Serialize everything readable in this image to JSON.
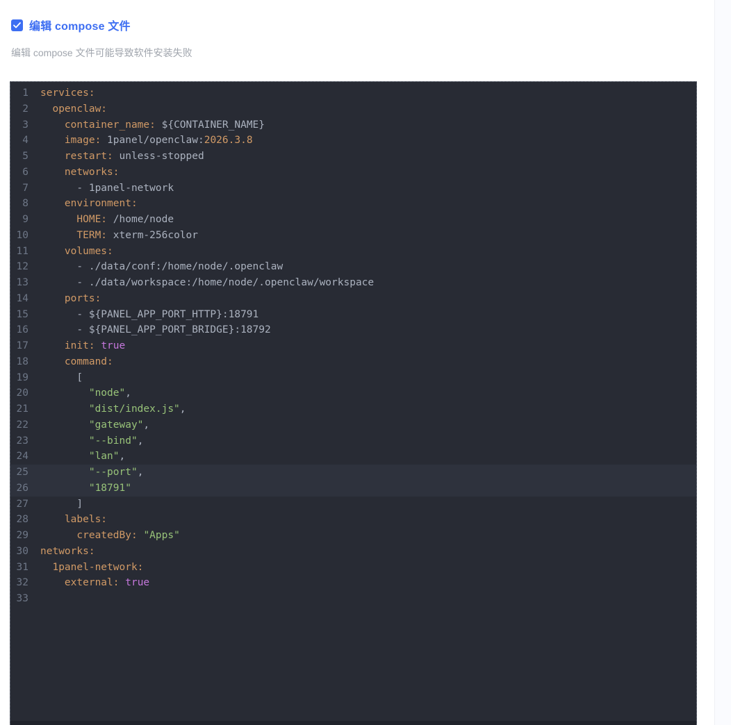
{
  "header": {
    "checkbox_checked": true,
    "title": "编辑 compose 文件",
    "subtitle": "编辑 compose 文件可能导致软件安装失败"
  },
  "colors": {
    "accent": "#3d6ef2",
    "subtitle_text": "#a0a5ad",
    "editor_background": "#282b34",
    "editor_border": "#8a919e",
    "gutter_number": "#6e7787",
    "line_highlight": "#2e323d",
    "syntax_key": "#d19a66",
    "syntax_plain": "#abb2bf",
    "syntax_string": "#98c379",
    "syntax_keyword": "#c678dd",
    "syntax_number": "#d19a66"
  },
  "editor": {
    "language": "yaml",
    "highlighted_lines": [
      25,
      26
    ],
    "lines": [
      {
        "n": 1,
        "segs": [
          [
            "k",
            "services:"
          ]
        ]
      },
      {
        "n": 2,
        "segs": [
          [
            "d",
            "  "
          ],
          [
            "k",
            "openclaw:"
          ]
        ]
      },
      {
        "n": 3,
        "segs": [
          [
            "d",
            "    "
          ],
          [
            "k",
            "container_name:"
          ],
          [
            "d",
            " ${CONTAINER_NAME}"
          ]
        ]
      },
      {
        "n": 4,
        "segs": [
          [
            "d",
            "    "
          ],
          [
            "k",
            "image:"
          ],
          [
            "d",
            " 1panel/openclaw:"
          ],
          [
            "n",
            "2026.3.8"
          ]
        ]
      },
      {
        "n": 5,
        "segs": [
          [
            "d",
            "    "
          ],
          [
            "k",
            "restart:"
          ],
          [
            "d",
            " unless-stopped"
          ]
        ]
      },
      {
        "n": 6,
        "segs": [
          [
            "d",
            "    "
          ],
          [
            "k",
            "networks:"
          ]
        ]
      },
      {
        "n": 7,
        "segs": [
          [
            "d",
            "      - 1panel-network"
          ]
        ]
      },
      {
        "n": 8,
        "segs": [
          [
            "d",
            "    "
          ],
          [
            "k",
            "environment:"
          ]
        ]
      },
      {
        "n": 9,
        "segs": [
          [
            "d",
            "      "
          ],
          [
            "k",
            "HOME:"
          ],
          [
            "d",
            " /home/node"
          ]
        ]
      },
      {
        "n": 10,
        "segs": [
          [
            "d",
            "      "
          ],
          [
            "k",
            "TERM:"
          ],
          [
            "d",
            " xterm-256color"
          ]
        ]
      },
      {
        "n": 11,
        "segs": [
          [
            "d",
            "    "
          ],
          [
            "k",
            "volumes:"
          ]
        ]
      },
      {
        "n": 12,
        "segs": [
          [
            "d",
            "      - ./data/conf:/home/node/.openclaw"
          ]
        ]
      },
      {
        "n": 13,
        "segs": [
          [
            "d",
            "      - ./data/workspace:/home/node/.openclaw/workspace"
          ]
        ]
      },
      {
        "n": 14,
        "segs": [
          [
            "d",
            "    "
          ],
          [
            "k",
            "ports:"
          ]
        ]
      },
      {
        "n": 15,
        "segs": [
          [
            "d",
            "      - ${PANEL_APP_PORT_HTTP}:18791"
          ]
        ]
      },
      {
        "n": 16,
        "segs": [
          [
            "d",
            "      - ${PANEL_APP_PORT_BRIDGE}:18792"
          ]
        ]
      },
      {
        "n": 17,
        "segs": [
          [
            "d",
            "    "
          ],
          [
            "k",
            "init:"
          ],
          [
            "d",
            " "
          ],
          [
            "b",
            "true"
          ]
        ]
      },
      {
        "n": 18,
        "segs": [
          [
            "d",
            "    "
          ],
          [
            "k",
            "command:"
          ]
        ]
      },
      {
        "n": 19,
        "segs": [
          [
            "d",
            "      ["
          ]
        ]
      },
      {
        "n": 20,
        "segs": [
          [
            "d",
            "        "
          ],
          [
            "s",
            "\"node\""
          ],
          [
            "d",
            ","
          ]
        ]
      },
      {
        "n": 21,
        "segs": [
          [
            "d",
            "        "
          ],
          [
            "s",
            "\"dist/index.js\""
          ],
          [
            "d",
            ","
          ]
        ]
      },
      {
        "n": 22,
        "segs": [
          [
            "d",
            "        "
          ],
          [
            "s",
            "\"gateway\""
          ],
          [
            "d",
            ","
          ]
        ]
      },
      {
        "n": 23,
        "segs": [
          [
            "d",
            "        "
          ],
          [
            "s",
            "\"--bind\""
          ],
          [
            "d",
            ","
          ]
        ]
      },
      {
        "n": 24,
        "segs": [
          [
            "d",
            "        "
          ],
          [
            "s",
            "\"lan\""
          ],
          [
            "d",
            ","
          ]
        ]
      },
      {
        "n": 25,
        "segs": [
          [
            "d",
            "        "
          ],
          [
            "s",
            "\"--port\""
          ],
          [
            "d",
            ","
          ]
        ]
      },
      {
        "n": 26,
        "segs": [
          [
            "d",
            "        "
          ],
          [
            "s",
            "\"18791\""
          ]
        ]
      },
      {
        "n": 27,
        "segs": [
          [
            "d",
            "      ]"
          ]
        ]
      },
      {
        "n": 28,
        "segs": [
          [
            "d",
            "    "
          ],
          [
            "k",
            "labels:"
          ]
        ]
      },
      {
        "n": 29,
        "segs": [
          [
            "d",
            "      "
          ],
          [
            "k",
            "createdBy:"
          ],
          [
            "d",
            " "
          ],
          [
            "s",
            "\"Apps\""
          ]
        ]
      },
      {
        "n": 30,
        "segs": [
          [
            "k",
            "networks:"
          ]
        ]
      },
      {
        "n": 31,
        "segs": [
          [
            "d",
            "  "
          ],
          [
            "k",
            "1panel-network:"
          ]
        ]
      },
      {
        "n": 32,
        "segs": [
          [
            "d",
            "    "
          ],
          [
            "k",
            "external:"
          ],
          [
            "d",
            " "
          ],
          [
            "b",
            "true"
          ]
        ]
      },
      {
        "n": 33,
        "segs": []
      }
    ]
  }
}
